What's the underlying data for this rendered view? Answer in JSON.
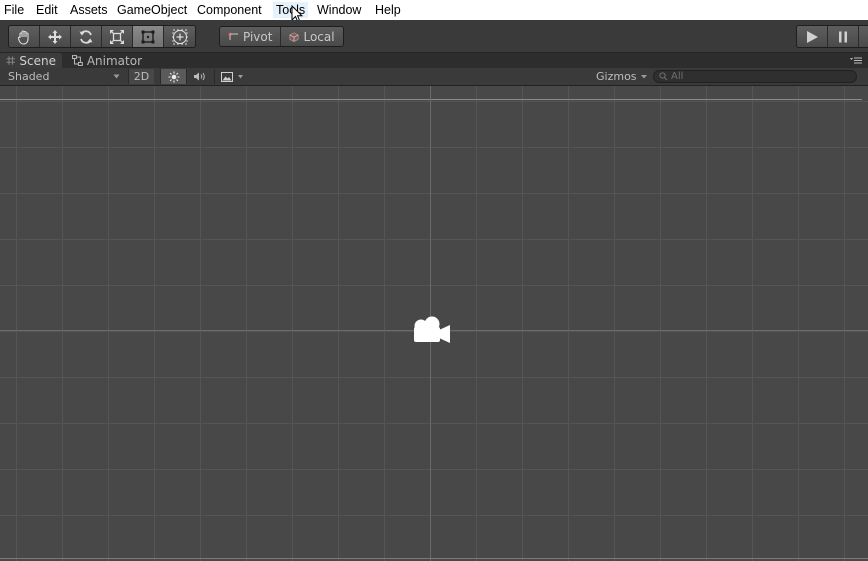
{
  "menubar": {
    "items": [
      "File",
      "Edit",
      "Assets",
      "GameObject",
      "Component",
      "Tools",
      "Window",
      "Help"
    ],
    "hovered": "Tools"
  },
  "toolbar": {
    "transform_tools": [
      {
        "icon": "hand-icon",
        "active": false
      },
      {
        "icon": "move-icon",
        "active": false
      },
      {
        "icon": "rotate-icon",
        "active": false
      },
      {
        "icon": "scale-icon",
        "active": false
      },
      {
        "icon": "rect-tool-icon",
        "active": true
      },
      {
        "icon": "transform-tool-icon",
        "active": false
      }
    ],
    "pivot_label": "Pivot",
    "local_label": "Local",
    "play_controls": [
      "play-icon",
      "pause-icon"
    ]
  },
  "tabs": [
    {
      "label": "Scene",
      "icon": "grid-icon",
      "active": true
    },
    {
      "label": "Animator",
      "icon": "animator-icon",
      "active": false
    }
  ],
  "scenebar": {
    "shading_mode": "Shaded",
    "mode_2d": "2D",
    "gizmos_label": "Gizmos",
    "search_placeholder": "All"
  },
  "colors": {
    "menubar_bg": "#ffffff",
    "toolbar_bg": "#3a3a3a",
    "viewport_bg": "#484848",
    "grid_line": "#555555",
    "active_tool": "#7e7e7e"
  }
}
